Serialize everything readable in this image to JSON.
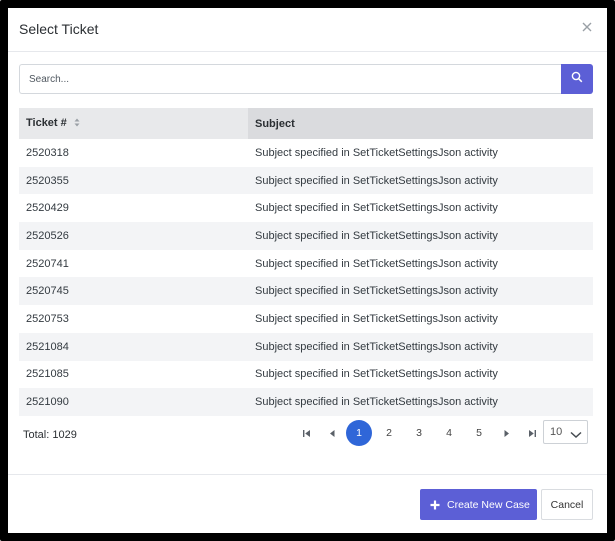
{
  "dialog": {
    "title": "Select Ticket"
  },
  "search": {
    "placeholder": "Search...",
    "value": ""
  },
  "table": {
    "columns": [
      "Ticket #",
      "Subject"
    ],
    "rows": [
      {
        "ticket": "2520318",
        "subject": "Subject specified in SetTicketSettingsJson activity"
      },
      {
        "ticket": "2520355",
        "subject": "Subject specified in SetTicketSettingsJson activity"
      },
      {
        "ticket": "2520429",
        "subject": "Subject specified in SetTicketSettingsJson activity"
      },
      {
        "ticket": "2520526",
        "subject": "Subject specified in SetTicketSettingsJson activity"
      },
      {
        "ticket": "2520741",
        "subject": "Subject specified in SetTicketSettingsJson activity"
      },
      {
        "ticket": "2520745",
        "subject": "Subject specified in SetTicketSettingsJson activity"
      },
      {
        "ticket": "2520753",
        "subject": "Subject specified in SetTicketSettingsJson activity"
      },
      {
        "ticket": "2521084",
        "subject": "Subject specified in SetTicketSettingsJson activity"
      },
      {
        "ticket": "2521085",
        "subject": "Subject specified in SetTicketSettingsJson activity"
      },
      {
        "ticket": "2521090",
        "subject": "Subject specified in SetTicketSettingsJson activity"
      }
    ]
  },
  "pagination": {
    "total_label": "Total: 1029",
    "pages": [
      "1",
      "2",
      "3",
      "4",
      "5"
    ],
    "current_page": "1",
    "page_size": "10"
  },
  "footer": {
    "create_label": "Create New Case",
    "cancel_label": "Cancel"
  },
  "colors": {
    "accent": "#5c5fd6",
    "active_page": "#2f66d8"
  },
  "icons": {
    "close": "close-icon",
    "search": "search-icon",
    "sort": "sort-icon",
    "first": "first-page-icon",
    "prev": "prev-page-icon",
    "next": "next-page-icon",
    "last": "last-page-icon",
    "chevron": "chevron-down-icon",
    "plus": "plus-icon"
  }
}
